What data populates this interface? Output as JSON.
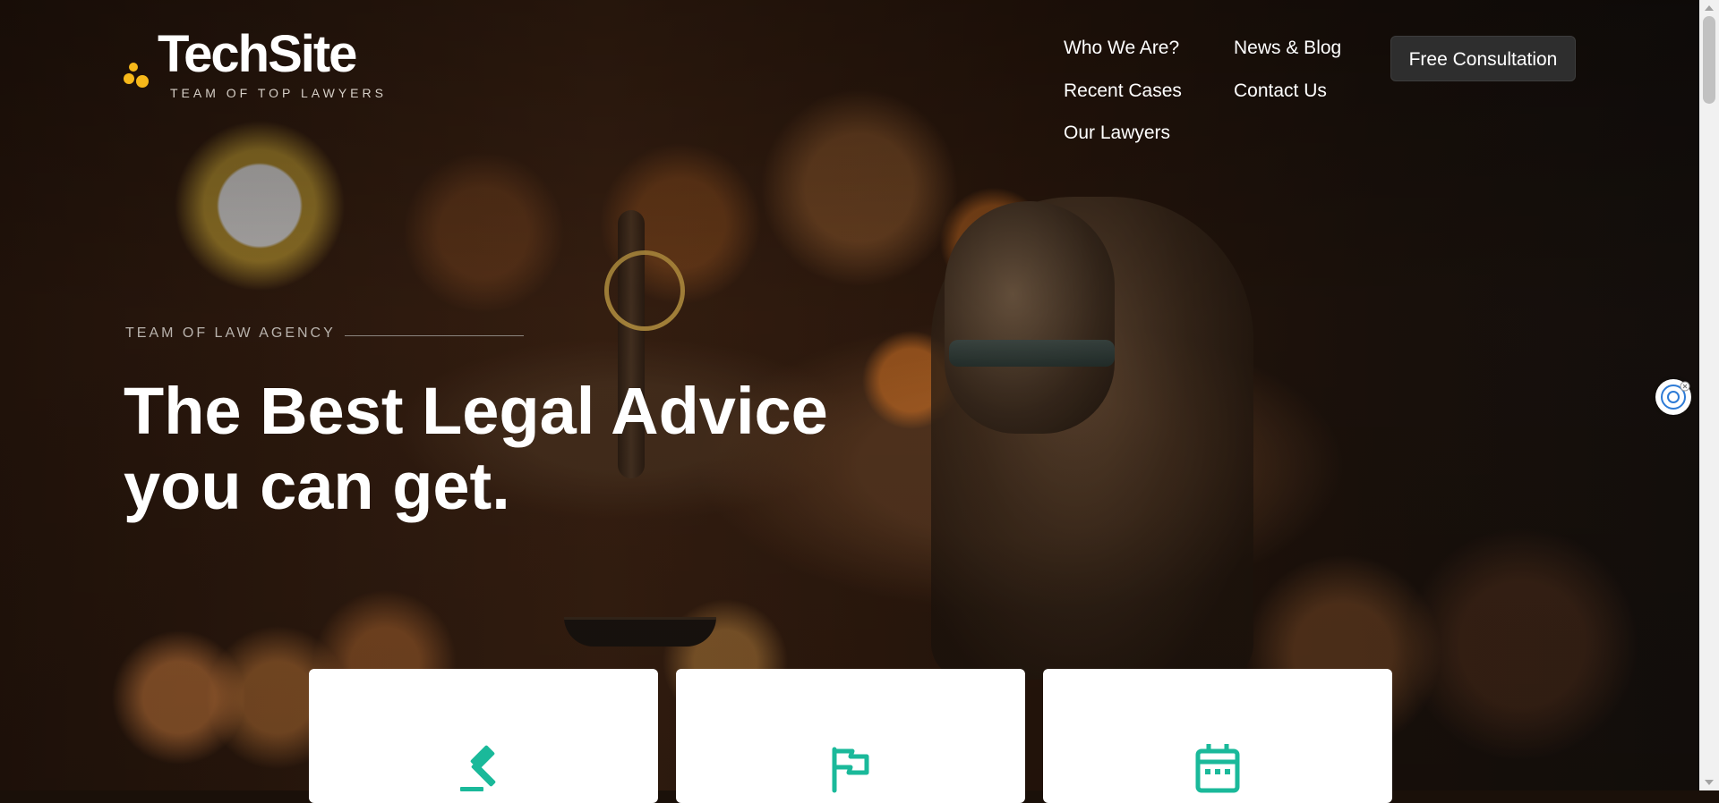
{
  "brand": {
    "name": "TechSite",
    "tagline": "TEAM OF TOP LAWYERS",
    "accent_color": "#f6b81a"
  },
  "nav": {
    "items": [
      {
        "label": "Who We Are?"
      },
      {
        "label": "News & Blog"
      },
      {
        "label": "Recent Cases"
      },
      {
        "label": "Contact Us"
      },
      {
        "label": "Our Lawyers"
      }
    ],
    "cta_label": "Free Consultation"
  },
  "hero": {
    "eyebrow": "TEAM OF LAW AGENCY",
    "headline_line1": "The Best Legal Advice",
    "headline_line2": "you can get."
  },
  "cards": [
    {
      "icon": "gavel-icon",
      "color": "#1ab99a"
    },
    {
      "icon": "flag-icon",
      "color": "#1ab99a"
    },
    {
      "icon": "calendar-icon",
      "color": "#1ab99a"
    }
  ],
  "widget": {
    "icon": "ai-assistant-icon"
  }
}
